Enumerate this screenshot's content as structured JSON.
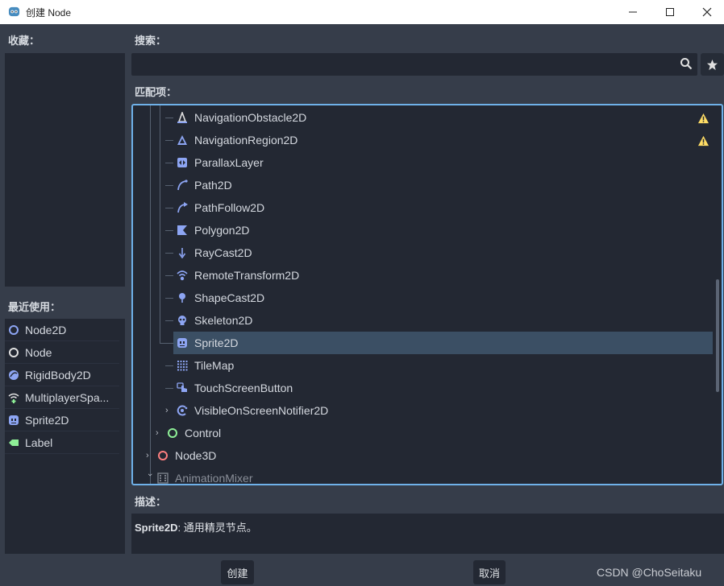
{
  "window": {
    "title": "创建 Node"
  },
  "labels": {
    "favorites": "收藏：",
    "recent": "最近使用：",
    "search": "搜索：",
    "matches": "匹配项：",
    "description": "描述："
  },
  "search": {
    "value": "",
    "placeholder": ""
  },
  "recent_items": [
    {
      "label": "Node2D",
      "icon": "node2d-icon"
    },
    {
      "label": "Node",
      "icon": "node-icon"
    },
    {
      "label": "RigidBody2D",
      "icon": "rigidbody2d-icon"
    },
    {
      "label": "MultiplayerSpa...",
      "icon": "multiplayer-spawner-icon"
    },
    {
      "label": "Sprite2D",
      "icon": "sprite2d-icon"
    },
    {
      "label": "Label",
      "icon": "label-icon"
    }
  ],
  "tree_items": [
    {
      "label": "NavigationObstacle2D",
      "icon": "navigation-obstacle2d-icon",
      "warning": true
    },
    {
      "label": "NavigationRegion2D",
      "icon": "navigation-region2d-icon",
      "warning": true
    },
    {
      "label": "ParallaxLayer",
      "icon": "parallax-layer-icon"
    },
    {
      "label": "Path2D",
      "icon": "path2d-icon"
    },
    {
      "label": "PathFollow2D",
      "icon": "path-follow2d-icon"
    },
    {
      "label": "Polygon2D",
      "icon": "polygon2d-icon"
    },
    {
      "label": "RayCast2D",
      "icon": "raycast2d-icon"
    },
    {
      "label": "RemoteTransform2D",
      "icon": "remote-transform2d-icon"
    },
    {
      "label": "ShapeCast2D",
      "icon": "shapecast2d-icon"
    },
    {
      "label": "Skeleton2D",
      "icon": "skeleton2d-icon"
    },
    {
      "label": "Sprite2D",
      "icon": "sprite2d-icon",
      "selected": true
    },
    {
      "label": "TileMap",
      "icon": "tilemap-icon"
    },
    {
      "label": "TouchScreenButton",
      "icon": "touch-screen-button-icon"
    },
    {
      "label": "VisibleOnScreenNotifier2D",
      "icon": "visible-on-screen-notifier2d-icon",
      "expandable": true
    },
    {
      "label": "Control",
      "icon": "control-icon",
      "expandable": true
    },
    {
      "label": "Node3D",
      "icon": "node3d-icon",
      "expandable": true
    },
    {
      "label": "AnimationMixer",
      "icon": "animation-mixer-icon",
      "expandable": true,
      "expanded": true,
      "dimmed": true
    }
  ],
  "description": {
    "name": "Sprite2D",
    "text": ": 通用精灵节点。"
  },
  "buttons": {
    "create": "创建",
    "cancel": "取消"
  },
  "watermark": "CSDN @ChoSeitaku",
  "colors": {
    "accent_2d": "#8da5f3",
    "accent_control": "#8eef97",
    "accent_3d": "#fc7f7f",
    "warning": "#ffdd65",
    "selection": "#3b4f64",
    "focus_border": "#6fb1e9"
  }
}
